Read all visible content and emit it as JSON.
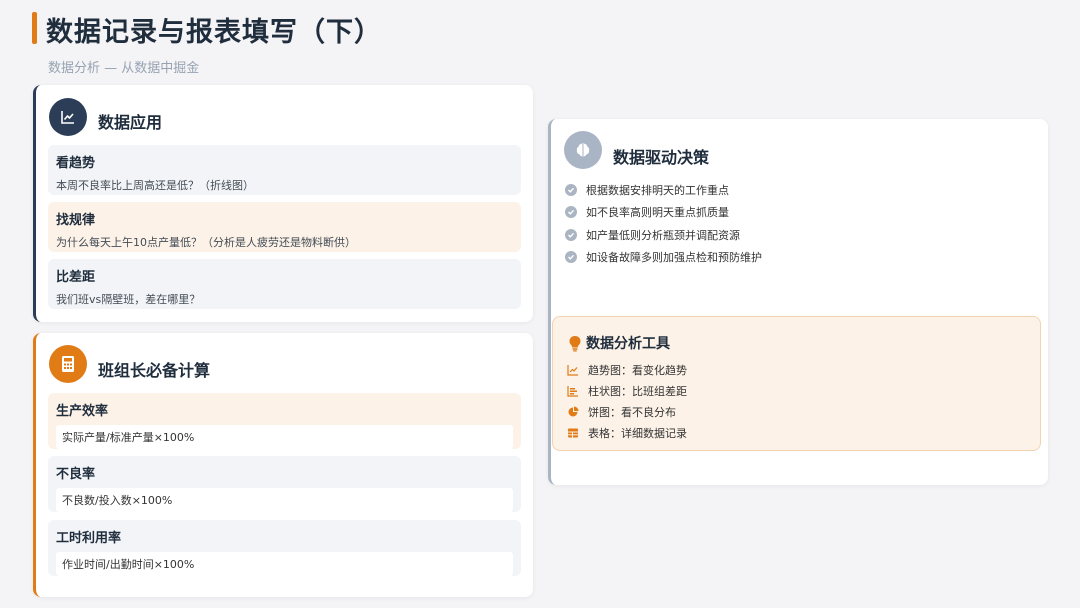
{
  "header": {
    "title": "数据记录与报表填写（下）",
    "subtitle": "数据分析 — 从数据中掘金"
  },
  "data_application": {
    "title": "数据应用",
    "icon": "line-chart-icon",
    "items": [
      {
        "title": "看趋势",
        "desc": "本周不良率比上周高还是低？（折线图）"
      },
      {
        "title": "找规律",
        "desc": "为什么每天上午10点产量低？（分析是人疲劳还是物料断供）"
      },
      {
        "title": "比差距",
        "desc": "我们班vs隔壁班，差在哪里？"
      }
    ]
  },
  "leader_calc": {
    "title": "班组长必备计算",
    "icon": "calculator-icon",
    "items": [
      {
        "title": "生产效率",
        "formula": "实际产量/标准产量×100%"
      },
      {
        "title": "不良率",
        "formula": "不良数/投入数×100%"
      },
      {
        "title": "工时利用率",
        "formula": "作业时间/出勤时间×100%"
      }
    ]
  },
  "decision": {
    "title": "数据驱动决策",
    "icon": "brain-icon",
    "items": [
      "根据数据安排明天的工作重点",
      "如不良率高则明天重点抓质量",
      "如产量低则分析瓶颈并调配资源",
      "如设备故障多则加强点检和预防维护"
    ]
  },
  "tools": {
    "title": "数据分析工具",
    "icon": "lightbulb-icon",
    "items": [
      {
        "icon": "trend-chart-icon",
        "label": "趋势图：看变化趋势"
      },
      {
        "icon": "bar-chart-icon",
        "label": "柱状图：比班组差距"
      },
      {
        "icon": "pie-chart-icon",
        "label": "饼图：看不良分布"
      },
      {
        "icon": "table-icon",
        "label": "表格：详细数据记录"
      }
    ]
  },
  "colors": {
    "navy": "#2c3e57",
    "orange": "#e07b16",
    "gray": "#a9b4c4",
    "peach": "#fcf2e8"
  }
}
